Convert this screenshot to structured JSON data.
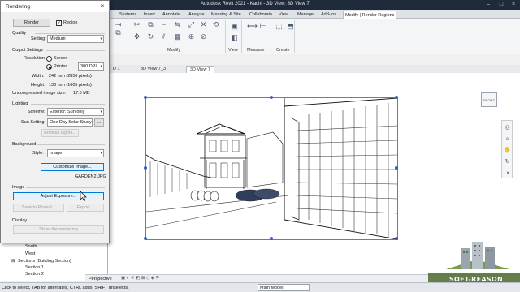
{
  "window": {
    "title": "Autodesk Revit 2021 - Kachi - 3D View: 3D View 7"
  },
  "ribbon": {
    "tabs": [
      "Systems",
      "Insert",
      "Annotate",
      "Analyze",
      "Massing & Site",
      "Collaborate",
      "View",
      "Manage",
      "Add-Ins",
      "Modify | Render Regions"
    ],
    "active_tab": "Modify | Render Regions",
    "groups": [
      "Modify",
      "View",
      "Measure",
      "Create"
    ]
  },
  "project_browser": {
    "items": [
      "South",
      "West",
      "Sections (Building Section)",
      "Section 1",
      "Section 2"
    ]
  },
  "view_tabs": [
    "D 1",
    "3D View 7_3",
    "3D View 7"
  ],
  "active_view_tab": "3D View 7",
  "view_cube_label": "FRONT",
  "view_control": {
    "perspective_label": "Perspective"
  },
  "status": {
    "message": "Click to select, TAB for alternates, CTRL adds, SHIFT unselects.",
    "model": "Main Model"
  },
  "dialog": {
    "title": "Rendering",
    "render_button": "Render",
    "region_label": "Region",
    "region_checked": true,
    "quality": {
      "section": "Quality",
      "setting_label": "Setting:",
      "setting_value": "Medium"
    },
    "output": {
      "section": "Output Settings",
      "resolution_label": "Resolution:",
      "screen_label": "Screen",
      "printer_label": "Printer",
      "printer_selected": true,
      "dpi_value": "300 DPI",
      "width_label": "Width:",
      "width_value": "242 mm (2856 pixels)",
      "height_label": "Height:",
      "height_value": "136 mm (1605 pixels)",
      "size_label": "Uncompressed image size:",
      "size_value": "17.5 MB"
    },
    "lighting": {
      "section": "Lighting",
      "scheme_label": "Scheme:",
      "scheme_value": "Exterior: Sun only",
      "sun_label": "Sun Setting:",
      "sun_value": "One Day Solar Study",
      "sun_button": "...",
      "artificial_button": "Artificial Lights..."
    },
    "background": {
      "section": "Background",
      "style_label": "Style:",
      "style_value": "Image",
      "customize_button": "Customize Image...",
      "file_name": "GARDEN2.JPG"
    },
    "image": {
      "section": "Image",
      "adjust_button": "Adjust Exposure...",
      "save_button": "Save to Project...",
      "export_button": "Export..."
    },
    "display": {
      "section": "Display",
      "show_button": "Show the rendering"
    }
  },
  "watermark": "SOFT-REASON"
}
